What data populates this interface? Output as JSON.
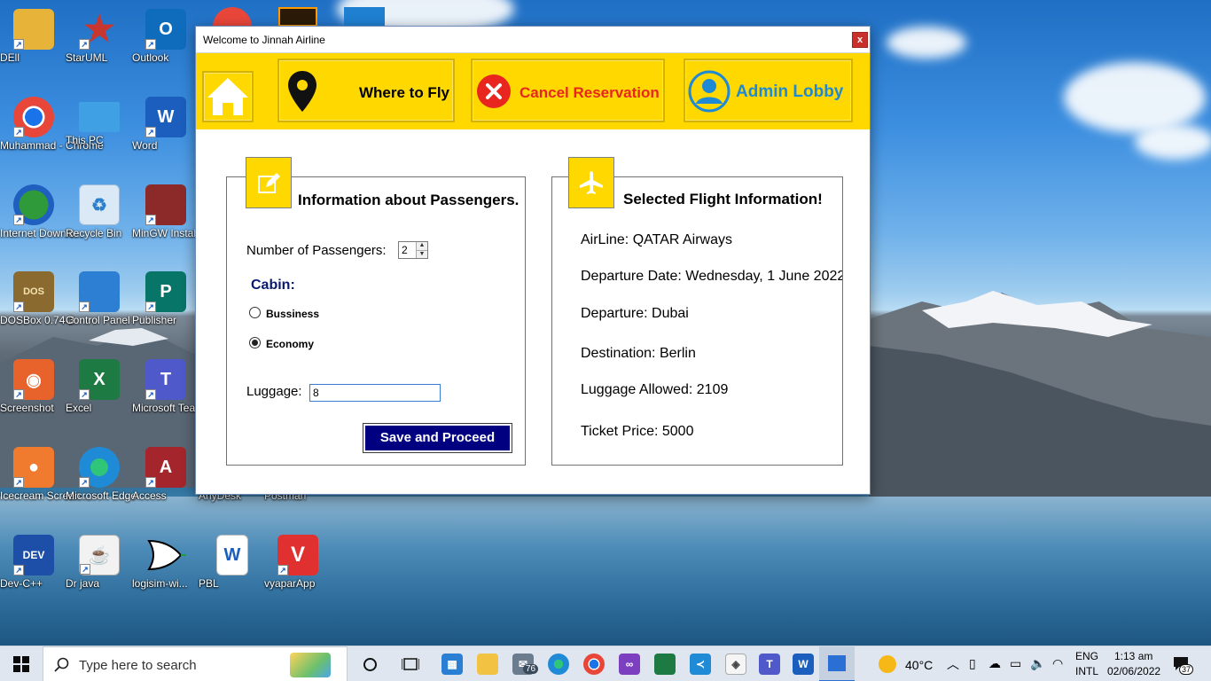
{
  "desktop": {
    "icons": [
      {
        "label": "DEll",
        "color": "#e8b339"
      },
      {
        "label": "StarUML",
        "color": "#c9362f"
      },
      {
        "label": "Outlook",
        "color": "#0f6cbd"
      },
      {
        "label": "Muhammad - Chrome",
        "color": "#e9463a"
      },
      {
        "label": "This PC",
        "color": "#3fa0e3"
      },
      {
        "label": "Word",
        "color": "#1b5ebe"
      },
      {
        "label": "Internet Downlo...",
        "color": "#2f9a3a"
      },
      {
        "label": "Recycle Bin",
        "color": "#9ec9ee"
      },
      {
        "label": "MinGW Installer",
        "color": "#8c2a2a"
      },
      {
        "label": "DOSBox 0.74-3",
        "color": "#8a6a2e"
      },
      {
        "label": "Control Panel",
        "color": "#2d7fd3"
      },
      {
        "label": "Publisher",
        "color": "#077568"
      },
      {
        "label": "Screenshot",
        "color": "#e8622c"
      },
      {
        "label": "Excel",
        "color": "#1d7a43"
      },
      {
        "label": "Microsoft Teams",
        "color": "#5059c9"
      },
      {
        "label": "Icecream Screen ...",
        "color": "#f07a2e"
      },
      {
        "label": "Microsoft Edge",
        "color": "#1f8ad6"
      },
      {
        "label": "Access",
        "color": "#a4262c"
      },
      {
        "label": "AnyDesk",
        "color": ""
      },
      {
        "label": "Postman",
        "color": ""
      },
      {
        "label": "Dev-C++",
        "color": "#1d4fa8"
      },
      {
        "label": "Dr java",
        "color": "#f2f2f2"
      },
      {
        "label": "logisim-wi...",
        "color": "#ffffff"
      },
      {
        "label": "PBL",
        "color": "#ffffff"
      },
      {
        "label": "vyaparApp",
        "color": "#e03030"
      }
    ]
  },
  "window": {
    "title": "Welcome to Jinnah Airline",
    "close_label": "x"
  },
  "nav": {
    "where_label": "Where to Fly",
    "cancel_label": "Cancel Reservation",
    "admin_label": "Admin Lobby",
    "cancel_color": "#e8261f",
    "admin_color": "#1e8ad6"
  },
  "passengers": {
    "title": "Information about Passengers.",
    "count_label": "Number of Passengers:",
    "count_value": "2",
    "cabin_label": "Cabin:",
    "options": [
      {
        "label": "Bussiness",
        "checked": false
      },
      {
        "label": "Economy",
        "checked": true
      }
    ],
    "luggage_label": "Luggage:",
    "luggage_value": "8",
    "save_label": "Save and Proceed"
  },
  "flight": {
    "title": "Selected Flight Information!",
    "airline": "AirLine:  QATAR Airways",
    "date": "Departure Date:  Wednesday, 1 June 2022",
    "departure": "Departure:  Dubai",
    "destination": "Destination:  Berlin",
    "luggage": "Luggage Allowed:  2109",
    "price": "Ticket Price:  5000"
  },
  "taskbar": {
    "search_placeholder": "Type here to search",
    "mail_badge": "76",
    "weather": "40°C",
    "lang_top": "ENG",
    "lang_bottom": "INTL",
    "time": "1:13 am",
    "date": "02/06/2022",
    "notif_count": "37"
  }
}
